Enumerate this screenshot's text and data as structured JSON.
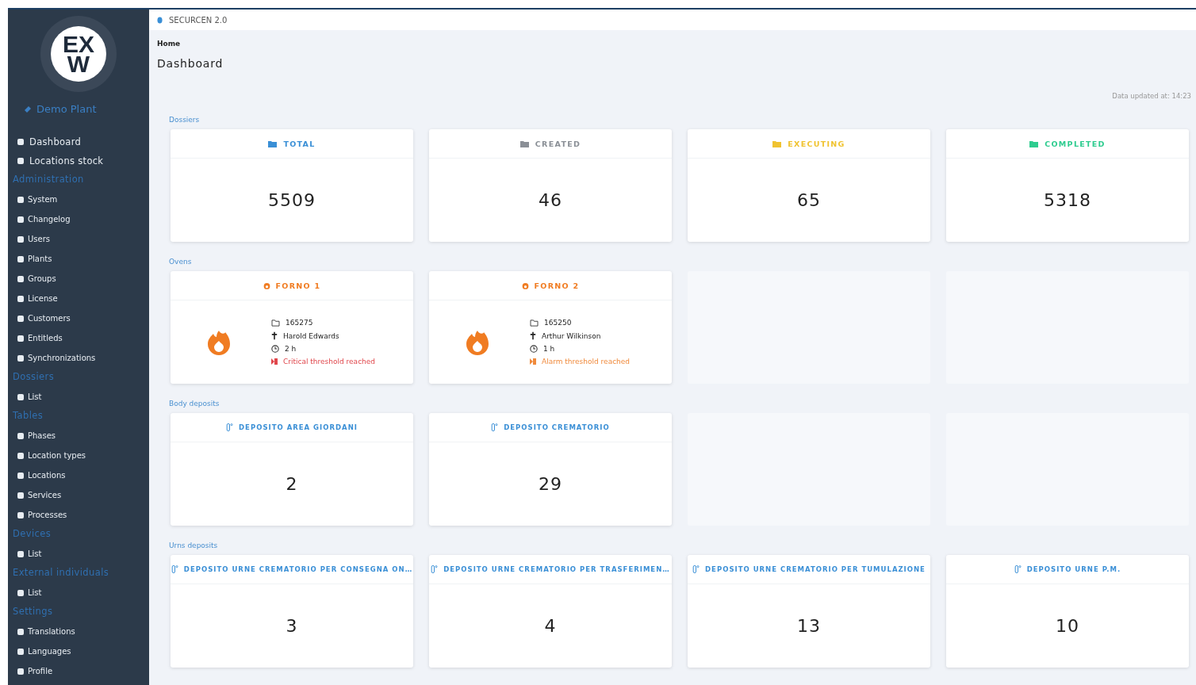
{
  "sidebar": {
    "logo": {
      "line_1": "EX",
      "line_2": "W"
    },
    "plant": "Demo Plant",
    "items": [
      {
        "kind": "main",
        "label": "Dashboard"
      },
      {
        "kind": "main",
        "label": "Locations stock"
      },
      {
        "kind": "heading",
        "label": "Administration"
      },
      {
        "kind": "item",
        "label": "System"
      },
      {
        "kind": "item",
        "label": "Changelog"
      },
      {
        "kind": "item",
        "label": "Users"
      },
      {
        "kind": "item",
        "label": "Plants"
      },
      {
        "kind": "item",
        "label": "Groups"
      },
      {
        "kind": "item",
        "label": "License"
      },
      {
        "kind": "item",
        "label": "Customers"
      },
      {
        "kind": "item",
        "label": "Entitleds"
      },
      {
        "kind": "item",
        "label": "Synchronizations"
      },
      {
        "kind": "heading",
        "label": "Dossiers"
      },
      {
        "kind": "item",
        "label": "List"
      },
      {
        "kind": "heading",
        "label": "Tables"
      },
      {
        "kind": "item",
        "label": "Phases"
      },
      {
        "kind": "item",
        "label": "Location types"
      },
      {
        "kind": "item",
        "label": "Locations"
      },
      {
        "kind": "item",
        "label": "Services"
      },
      {
        "kind": "item",
        "label": "Processes"
      },
      {
        "kind": "heading",
        "label": "Devices"
      },
      {
        "kind": "item",
        "label": "List"
      },
      {
        "kind": "heading",
        "label": "External individuals"
      },
      {
        "kind": "item",
        "label": "List"
      },
      {
        "kind": "heading",
        "label": "Settings"
      },
      {
        "kind": "item",
        "label": "Translations"
      },
      {
        "kind": "item",
        "label": "Languages"
      },
      {
        "kind": "item",
        "label": "Profile"
      }
    ]
  },
  "topbar": {
    "title": "SECURCEN 2.0"
  },
  "breadcrumb": "Home",
  "page_title": "Dashboard",
  "updated": "Data updated at: 14:23",
  "dossiers": {
    "label": "Dossiers",
    "cards": [
      {
        "title": "TOTAL",
        "value": "5509",
        "color": "#3a8fd6"
      },
      {
        "title": "CREATED",
        "value": "46",
        "color": "#8a8f96"
      },
      {
        "title": "EXECUTING",
        "value": "65",
        "color": "#f0c330"
      },
      {
        "title": "COMPLETED",
        "value": "5318",
        "color": "#2ecc8f"
      }
    ]
  },
  "ovens": {
    "label": "Ovens",
    "cards": [
      {
        "title": "FORNO 1",
        "dossier": "165275",
        "name": "Harold Edwards",
        "time": "2 h",
        "status": "Critical threshold reached",
        "color": "#e0474c"
      },
      {
        "title": "FORNO 2",
        "dossier": "165250",
        "name": "Arthur Wilkinson",
        "time": "1 h",
        "status": "Alarm threshold reached",
        "color": "#f08a3c"
      }
    ]
  },
  "body_deposits": {
    "label": "Body deposits",
    "cards": [
      {
        "title": "DEPOSITO AREA GIORDANI",
        "value": "2"
      },
      {
        "title": "DEPOSITO CREMATORIO",
        "value": "29"
      }
    ]
  },
  "urns_deposits": {
    "label": "Urns deposits",
    "cards": [
      {
        "title": "DEPOSITO URNE CREMATORIO PER CONSEGNA ON…",
        "value": "3"
      },
      {
        "title": "DEPOSITO URNE CREMATORIO PER TRASFERIMEN…",
        "value": "4"
      },
      {
        "title": "DEPOSITO URNE CREMATORIO PER TUMULAZIONE",
        "value": "13"
      },
      {
        "title": "DEPOSITO URNE P.M.",
        "value": "10"
      }
    ]
  }
}
